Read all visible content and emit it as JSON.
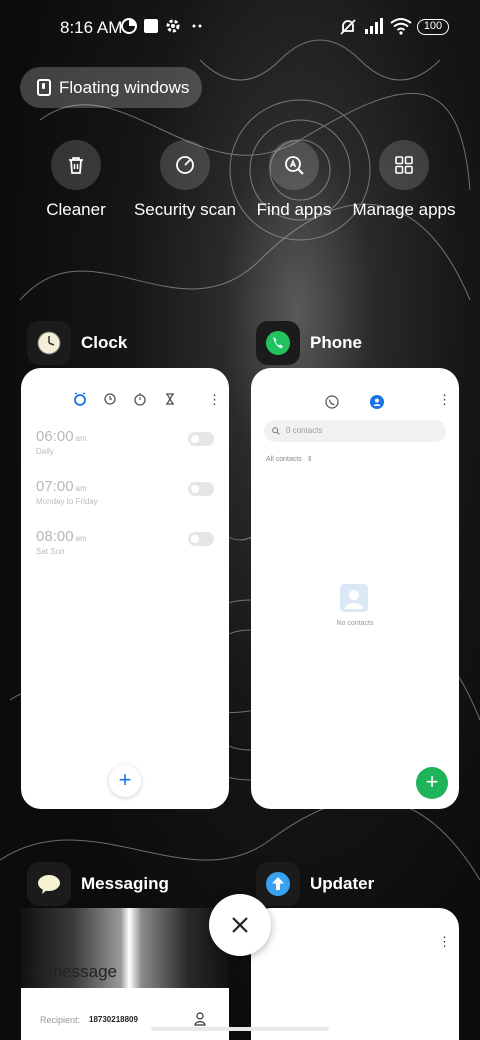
{
  "status_bar": {
    "time": "8:16 AM",
    "battery": "100",
    "icons": [
      "data-saver-icon",
      "square-notification-icon",
      "gear-icon",
      "more-dots-icon",
      "silent-mode-icon",
      "signal-icon",
      "wifi-icon"
    ]
  },
  "floating_windows": {
    "label": "Floating windows"
  },
  "quick_actions": [
    {
      "label": "Cleaner",
      "icon": "trash-icon"
    },
    {
      "label": "Security scan",
      "icon": "security-scan-icon"
    },
    {
      "label": "Find apps",
      "icon": "search-apps-icon"
    },
    {
      "label": "Manage apps",
      "icon": "grid-icon"
    }
  ],
  "apps": {
    "clock": {
      "title": "Clock",
      "alarms": [
        {
          "time": "06:00",
          "ampm": "am",
          "repeat": "Daily"
        },
        {
          "time": "07:00",
          "ampm": "am",
          "repeat": "Monday to Friday"
        },
        {
          "time": "08:00",
          "ampm": "am",
          "repeat": "Sat Sun"
        }
      ]
    },
    "phone": {
      "title": "Phone",
      "search_placeholder": "0 contacts",
      "filter_label": "All contacts",
      "empty_label": "No contacts"
    },
    "messaging": {
      "title": "Messaging",
      "header_text": "w message",
      "recipient_label": "Recipient:",
      "recipient_value": "18730218809"
    },
    "updater": {
      "title": "Updater"
    }
  },
  "colors": {
    "accent_blue": "#1a73e8",
    "phone_green": "#1fb35a",
    "pill_bg": "rgba(255,255,255,0.22)"
  }
}
